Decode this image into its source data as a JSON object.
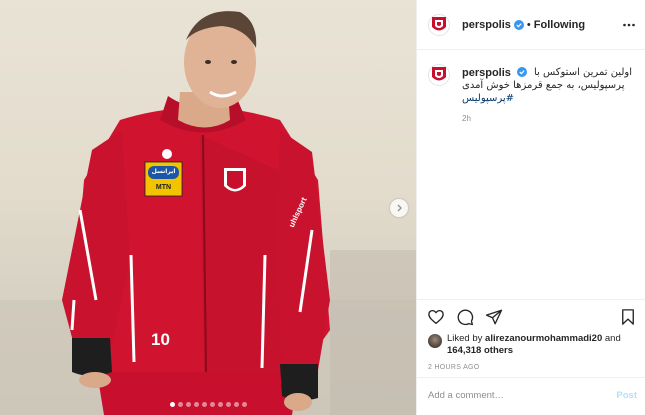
{
  "post": {
    "author": {
      "username": "perspolis",
      "verified": true,
      "avatar_icon": "persepolis-logo-icon"
    },
    "header": {
      "separator": "•",
      "follow_status": "Following",
      "more_icon": "more-options-icon"
    },
    "caption": {
      "username": "perspolis",
      "line1": "اولین تمرین استوکس با",
      "line2": "پرسپولیس، به جمع قرمزها خوش آمدی",
      "hashtag": "#پرسپولیس",
      "age": "2h"
    },
    "media": {
      "description_icon": "post-photo",
      "carousel_total": 10,
      "carousel_current": 1,
      "next_icon": "chevron-right-icon",
      "jersey_number": "10",
      "sponsor_text": "ایرانسل",
      "sponsor_sub": "MTN",
      "kit_brand": "uhlsport"
    },
    "actions": {
      "like_icon": "heart-icon",
      "comment_icon": "comment-icon",
      "share_icon": "share-icon",
      "save_icon": "bookmark-icon"
    },
    "likes": {
      "prefix": "Liked by ",
      "user": "alirezanourmohammadi20",
      "conjunction": " and",
      "others": "164,318 others"
    },
    "timestamp": "2 HOURS AGO",
    "comment": {
      "placeholder": "Add a comment…",
      "post_label": "Post"
    },
    "colors": {
      "brand_red": "#c8102e",
      "verified_blue": "#3897f0",
      "link_blue": "#00376b",
      "post_button_disabled": "#b2dffc"
    }
  }
}
